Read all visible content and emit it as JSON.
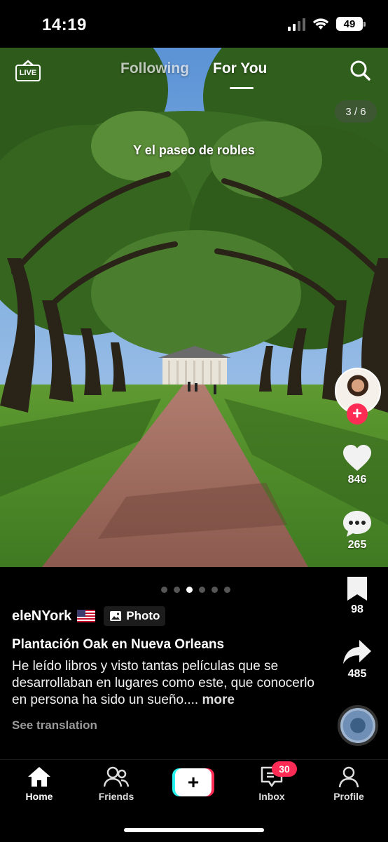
{
  "status_bar": {
    "time": "14:19",
    "battery": "49"
  },
  "top_nav": {
    "tabs": [
      "Following",
      "For You"
    ],
    "active_tab": "For You",
    "live_label": "LIVE"
  },
  "slide": {
    "counter": "3 / 6",
    "overlay_text": "Y el paseo de robles",
    "dot_count": 6,
    "active_dot": 3
  },
  "actions": {
    "likes": "846",
    "comments": "265",
    "saves": "98",
    "shares": "485"
  },
  "post": {
    "username": "eleNYork",
    "badge_label": "Photo",
    "title": "Plantación Oak en Nueva Orleans",
    "description": "He leído libros y visto tantas películas que se desarrollaban en lugares como este, que conocerlo en persona ha sido un sueño....",
    "more_label": "more",
    "translation_label": "See translation"
  },
  "bottom_nav": {
    "items": [
      {
        "label": "Home",
        "icon": "home-icon",
        "active": true
      },
      {
        "label": "Friends",
        "icon": "friends-icon"
      },
      {
        "label": "",
        "icon": "create-icon"
      },
      {
        "label": "Inbox",
        "icon": "inbox-icon",
        "badge": "30"
      },
      {
        "label": "Profile",
        "icon": "profile-icon"
      }
    ]
  },
  "colors": {
    "accent": "#fe2c55",
    "cyan": "#25f4ee",
    "background": "#000000"
  }
}
